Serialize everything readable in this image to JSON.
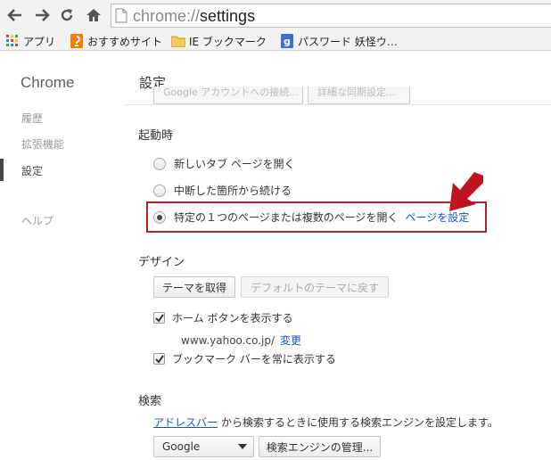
{
  "browser": {
    "url_scheme": "chrome://",
    "url_host": "settings",
    "icons": [
      "back-icon",
      "forward-icon",
      "reload-icon",
      "home-icon",
      "page-icon"
    ]
  },
  "bookmarks": [
    {
      "label": "アプリ",
      "icon": "apps-grid-icon"
    },
    {
      "label": "おすすめサイト",
      "icon": "suggest-site-icon"
    },
    {
      "label": "IE ブックマーク",
      "icon": "folder-icon"
    },
    {
      "label": "パスワード 妖怪ウ…",
      "icon": "g-page-icon"
    }
  ],
  "sidebar": {
    "title": "Chrome",
    "items": [
      {
        "label": "履歴"
      },
      {
        "label": "拡張機能"
      },
      {
        "label": "設定"
      },
      {
        "label": "ヘルプ"
      }
    ]
  },
  "main": {
    "title": "設定",
    "ghost_buttons": [
      "Google アカウントへの接続...",
      "詳細な同期設定..."
    ]
  },
  "startup": {
    "title": "起動時",
    "options": [
      {
        "label": "新しいタブ ページを開く",
        "checked": false
      },
      {
        "label": "中断した箇所から続ける",
        "checked": false
      },
      {
        "label": "特定の１つのページまたは複数のページを開く",
        "checked": true
      }
    ],
    "set_pages_link": "ページを設定"
  },
  "design": {
    "title": "デザイン",
    "get_theme_button": "テーマを取得",
    "reset_theme_button": "デフォルトのテーマに戻す",
    "show_home_button": {
      "label": "ホーム ボタンを表示する",
      "checked": true
    },
    "home_url": "www.yahoo.co.jp/",
    "change_link": "変更",
    "show_bookmarks_bar": {
      "label": "ブックマーク バーを常に表示する",
      "checked": true
    }
  },
  "search": {
    "title": "検索",
    "omnibox_link": "アドレスバー",
    "description": "から検索するときに使用する検索エンジンを設定します。",
    "engine_selected": "Google",
    "manage_button": "検索エンジンの管理..."
  },
  "colors": {
    "link": "#1155cc",
    "highlight_box": "#a8262a",
    "arrow": "#c0151f"
  }
}
